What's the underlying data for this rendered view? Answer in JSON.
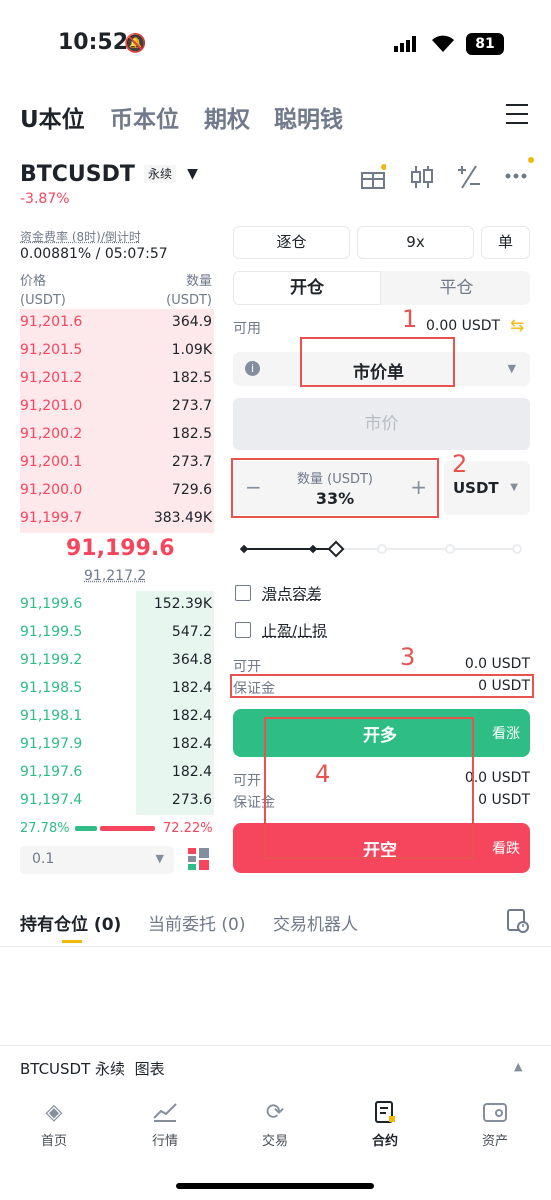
{
  "status": {
    "time": "10:52",
    "battery": "81"
  },
  "top_tabs": [
    "U本位",
    "币本位",
    "期权",
    "聪明钱"
  ],
  "symbol": {
    "name": "BTCUSDT",
    "tag": "永续",
    "change": "-3.87%"
  },
  "funding": {
    "label": "资金费率 (8时)/倒计时",
    "value": "0.00881% / 05:07:57"
  },
  "orderbook": {
    "price_label": "价格",
    "price_unit": "(USDT)",
    "qty_label": "数量",
    "qty_unit": "(USDT)",
    "asks": [
      {
        "p": "91,201.6",
        "q": "364.9"
      },
      {
        "p": "91,201.5",
        "q": "1.09K"
      },
      {
        "p": "91,201.2",
        "q": "182.5"
      },
      {
        "p": "91,201.0",
        "q": "273.7"
      },
      {
        "p": "91,200.2",
        "q": "182.5"
      },
      {
        "p": "91,200.1",
        "q": "273.7"
      },
      {
        "p": "91,200.0",
        "q": "729.6"
      },
      {
        "p": "91,199.7",
        "q": "383.49K"
      }
    ],
    "last_price": "91,199.6",
    "mark_price": "91,217.2",
    "bids": [
      {
        "p": "91,199.6",
        "q": "152.39K"
      },
      {
        "p": "91,199.5",
        "q": "547.2"
      },
      {
        "p": "91,199.2",
        "q": "364.8"
      },
      {
        "p": "91,198.5",
        "q": "182.4"
      },
      {
        "p": "91,198.1",
        "q": "182.4"
      },
      {
        "p": "91,197.9",
        "q": "182.4"
      },
      {
        "p": "91,197.6",
        "q": "182.4"
      },
      {
        "p": "91,197.4",
        "q": "273.6"
      }
    ],
    "buy_ratio": "27.78%",
    "sell_ratio": "72.22%",
    "depth": "0.1"
  },
  "trade": {
    "margin_mode": "逐仓",
    "leverage": "9x",
    "position_mode": "单",
    "tab_open": "开仓",
    "tab_close": "平仓",
    "available_label": "可用",
    "available_value": "0.00 USDT",
    "order_type": "市价单",
    "price_placeholder": "市价",
    "qty_label": "数量 (USDT)",
    "qty_value": "33%",
    "qty_unit": "USDT",
    "slippage": "滑点容差",
    "tpsl": "止盈/止损",
    "open_label": "可开",
    "open_value": "0.0 USDT",
    "margin_label": "保证金",
    "margin_value": "0 USDT",
    "long_btn": "开多",
    "long_hint": "看涨",
    "open_label2": "可开",
    "open_value2": "0.0 USDT",
    "margin_label2": "保证金",
    "margin_value2": "0 USDT",
    "short_btn": "开空",
    "short_hint": "看跌"
  },
  "annotations": [
    "1",
    "2",
    "3",
    "4"
  ],
  "bottom_tabs": [
    "持有仓位 (0)",
    "当前委托 (0)",
    "交易机器人"
  ],
  "chart_bar": "BTCUSDT 永续  图表",
  "nav": [
    "首页",
    "行情",
    "交易",
    "合约",
    "资产"
  ]
}
